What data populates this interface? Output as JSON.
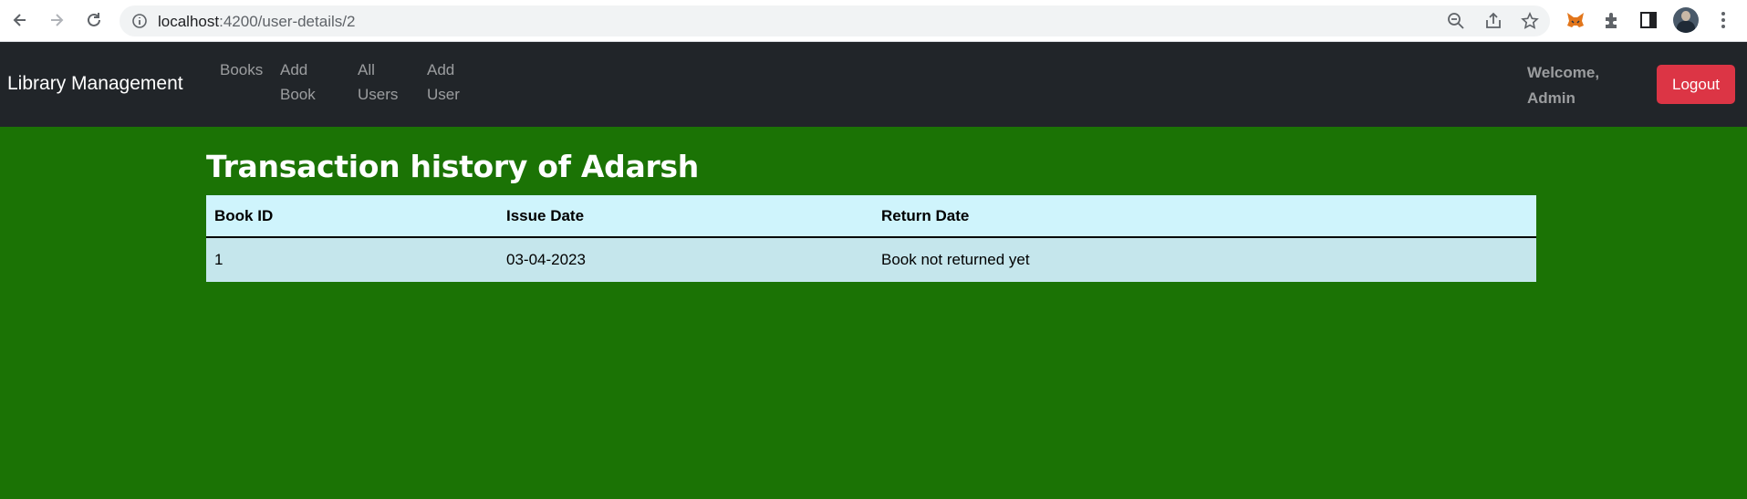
{
  "browser": {
    "url_host": "localhost",
    "url_path": ":4200/user-details/2"
  },
  "navbar": {
    "brand": "Library Management",
    "links": [
      {
        "line1": "Books",
        "line2": ""
      },
      {
        "line1": "Add",
        "line2": "Book"
      },
      {
        "line1": "All",
        "line2": "Users"
      },
      {
        "line1": "Add",
        "line2": "User"
      }
    ],
    "welcome_line1": "Welcome,",
    "welcome_line2": "Admin",
    "logout_label": "Logout"
  },
  "page": {
    "title": "Transaction history of Adarsh"
  },
  "table": {
    "headers": [
      "Book ID",
      "Issue Date",
      "Return Date"
    ],
    "rows": [
      [
        "1",
        "03-04-2023",
        "Book not returned yet"
      ]
    ]
  },
  "colors": {
    "page_background": "#1b7305",
    "navbar_background": "#212529",
    "logout_button": "#dc3545",
    "table_header": "#cff4fc",
    "table_row": "#c5e6ec"
  }
}
